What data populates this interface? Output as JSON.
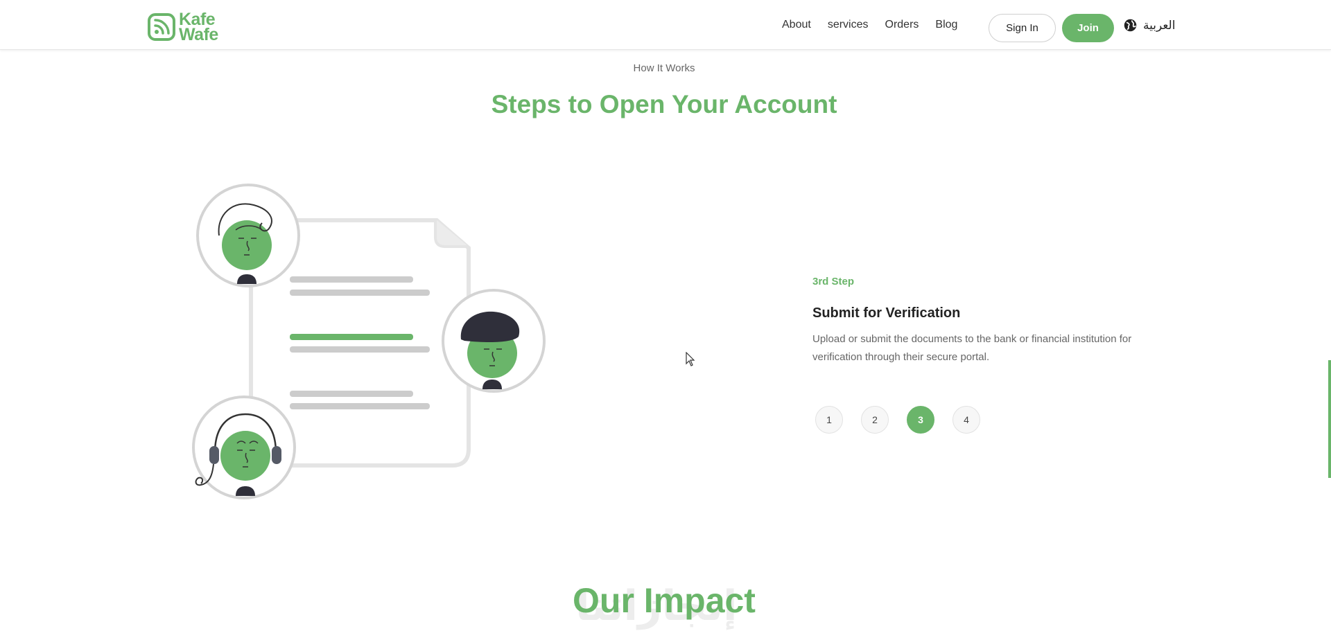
{
  "brand": {
    "line1": "Kafe",
    "line2": "Wafe",
    "color": "#6ab56a"
  },
  "nav": {
    "items": [
      {
        "label": "About"
      },
      {
        "label": "services"
      },
      {
        "label": "Orders"
      },
      {
        "label": "Blog"
      }
    ],
    "signin_label": "Sign In",
    "join_label": "Join",
    "language_label": "العربية",
    "language_icon": "globe-icon"
  },
  "section": {
    "eyebrow": "How It Works",
    "title": "Steps to Open Your Account"
  },
  "step": {
    "label": "3rd Step",
    "title": "Submit for Verification",
    "description": "Upload or submit the documents to the bank or financial institution for verification through their secure portal."
  },
  "pager": {
    "pages": [
      "1",
      "2",
      "3",
      "4"
    ],
    "active": "3"
  },
  "impact": {
    "title": "Our Impact",
    "ghost_text": "إنجازاتنا"
  },
  "colors": {
    "accent": "#6ab56a",
    "text": "#222222",
    "muted": "#666666"
  }
}
